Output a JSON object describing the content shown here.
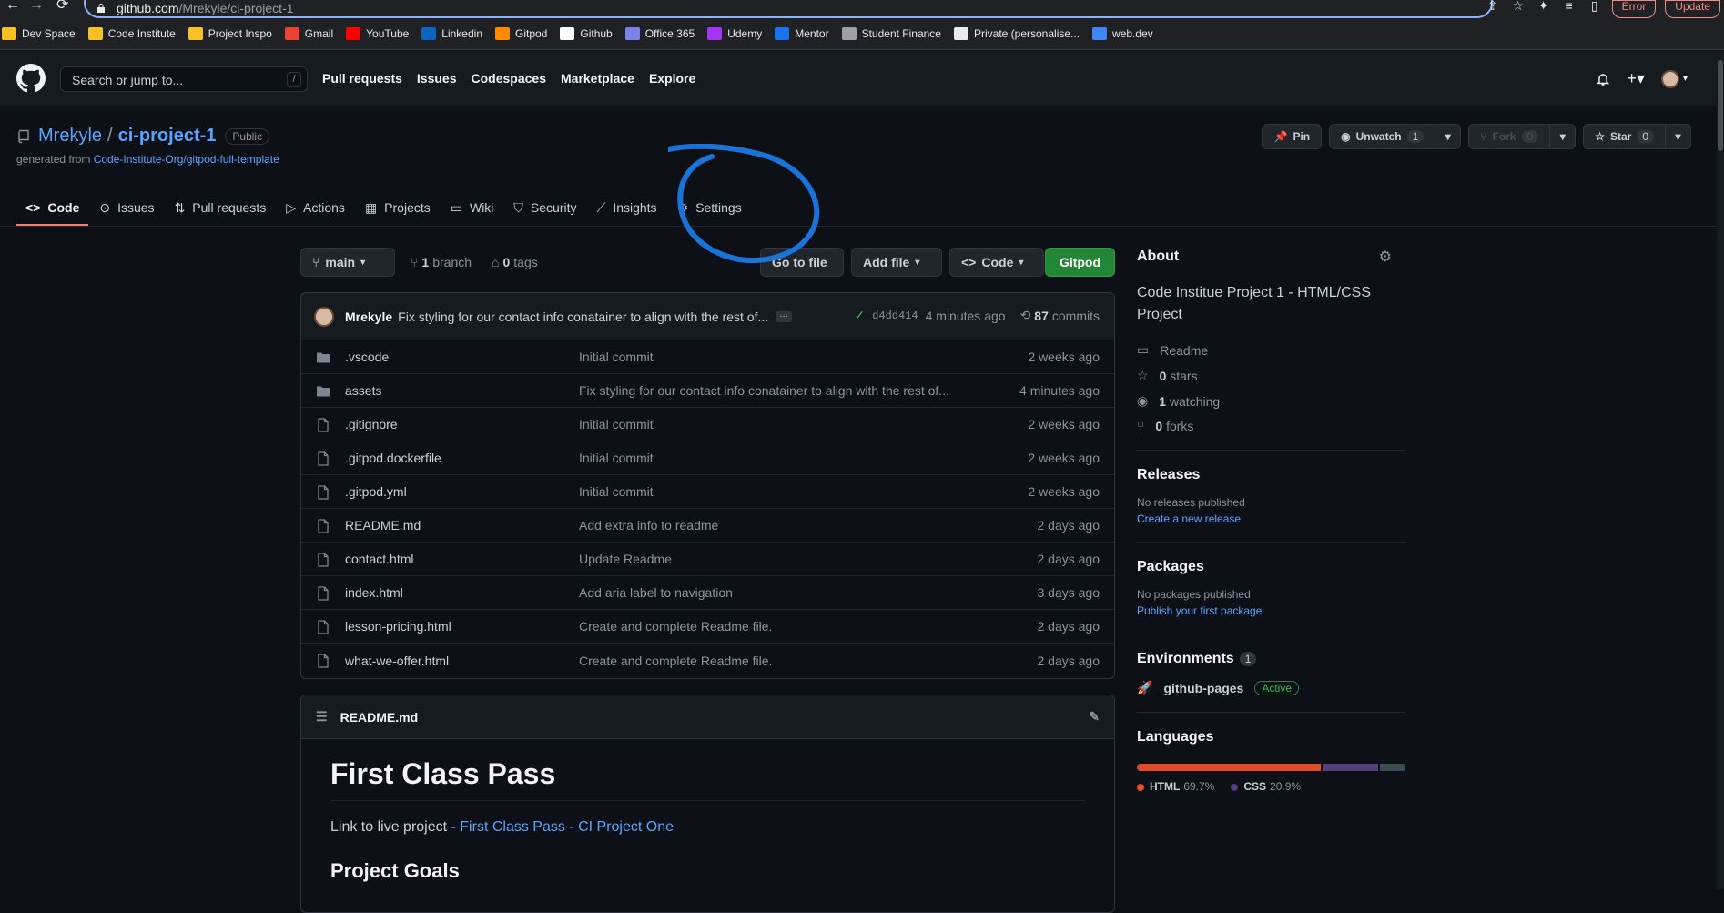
{
  "browser": {
    "url_host": "github.com",
    "url_path": "/Mrekyle/ci-project-1",
    "error_label": "Error",
    "update_label": "Update"
  },
  "bookmarks": [
    {
      "label": "Dev Space",
      "color": "#f6c026"
    },
    {
      "label": "Code Institute",
      "color": "#f6c026"
    },
    {
      "label": "Project Inspo",
      "color": "#f6c026"
    },
    {
      "label": "Gmail",
      "color": "#ea4335"
    },
    {
      "label": "YouTube",
      "color": "#ff0000"
    },
    {
      "label": "Linkedin",
      "color": "#0a66c2"
    },
    {
      "label": "Gitpod",
      "color": "#ff8a00"
    },
    {
      "label": "Github",
      "color": "#ffffff"
    },
    {
      "label": "Office 365",
      "color": "#7b83eb"
    },
    {
      "label": "Udemy",
      "color": "#a435f0"
    },
    {
      "label": "Mentor",
      "color": "#1a73e8"
    },
    {
      "label": "Student Finance",
      "color": "#9aa0a6"
    },
    {
      "label": "Private (personalise...",
      "color": "#e8eaed"
    },
    {
      "label": "web.dev",
      "color": "#4285f4"
    }
  ],
  "header": {
    "search_placeholder": "Search or jump to...",
    "search_shortcut": "/",
    "nav": [
      "Pull requests",
      "Issues",
      "Codespaces",
      "Marketplace",
      "Explore"
    ]
  },
  "repo": {
    "owner": "Mrekyle",
    "sep": "/",
    "name": "ci-project-1",
    "visibility": "Public",
    "generated_prefix": "generated from ",
    "generated_link": "Code-Institute-Org/gitpod-full-template",
    "actions": {
      "pin": "Pin",
      "unwatch": "Unwatch",
      "watch_count": "1",
      "fork": "Fork",
      "fork_count": "0",
      "star": "Star",
      "star_count": "0"
    },
    "tabs": [
      "Code",
      "Issues",
      "Pull requests",
      "Actions",
      "Projects",
      "Wiki",
      "Security",
      "Insights",
      "Settings"
    ]
  },
  "toolbar": {
    "branch": "main",
    "branch_count": "1",
    "branch_label": "branch",
    "tag_count": "0",
    "tag_label": "tags",
    "goto_file": "Go to file",
    "add_file": "Add file",
    "code": "Code",
    "gitpod": "Gitpod"
  },
  "commit": {
    "author": "Mrekyle",
    "message": "Fix styling for our contact info conatainer to align with the rest of...",
    "ellipsis": "…",
    "sha": "d4dd414",
    "time": "4 minutes ago",
    "count": "87",
    "count_label": "commits"
  },
  "files": [
    {
      "type": "dir",
      "name": ".vscode",
      "message": "Initial commit",
      "age": "2 weeks ago"
    },
    {
      "type": "dir",
      "name": "assets",
      "message": "Fix styling for our contact info conatainer to align with the rest of...",
      "age": "4 minutes ago"
    },
    {
      "type": "file",
      "name": ".gitignore",
      "message": "Initial commit",
      "age": "2 weeks ago"
    },
    {
      "type": "file",
      "name": ".gitpod.dockerfile",
      "message": "Initial commit",
      "age": "2 weeks ago"
    },
    {
      "type": "file",
      "name": ".gitpod.yml",
      "message": "Initial commit",
      "age": "2 weeks ago"
    },
    {
      "type": "file",
      "name": "README.md",
      "message": "Add extra info to readme",
      "age": "2 days ago"
    },
    {
      "type": "file",
      "name": "contact.html",
      "message": "Update Readme",
      "age": "2 days ago"
    },
    {
      "type": "file",
      "name": "index.html",
      "message": "Add aria label to navigation",
      "age": "3 days ago"
    },
    {
      "type": "file",
      "name": "lesson-pricing.html",
      "message": "Create and complete Readme file.",
      "age": "2 days ago"
    },
    {
      "type": "file",
      "name": "what-we-offer.html",
      "message": "Create and complete Readme file.",
      "age": "2 days ago"
    }
  ],
  "readme": {
    "filename": "README.md",
    "h1": "First Class Pass",
    "live_prefix": "Link to live project - ",
    "live_link": "First Class Pass - CI Project One",
    "h2": "Project Goals"
  },
  "sidebar": {
    "about_title": "About",
    "about_desc": "Code Institue Project 1 - HTML/CSS Project",
    "readme": "Readme",
    "stars_count": "0",
    "stars_label": "stars",
    "watching_count": "1",
    "watching_label": "watching",
    "forks_count": "0",
    "forks_label": "forks",
    "releases_title": "Releases",
    "releases_none": "No releases published",
    "releases_link": "Create a new release",
    "packages_title": "Packages",
    "packages_none": "No packages published",
    "packages_link": "Publish your first package",
    "environments_title": "Environments",
    "environments_count": "1",
    "env_name": "github-pages",
    "env_status": "Active",
    "languages_title": "Languages",
    "languages": [
      {
        "name": "HTML",
        "percent": "69.7%",
        "value": 69.7,
        "color": "#e34c26"
      },
      {
        "name": "CSS",
        "percent": "20.9%",
        "value": 20.9,
        "color": "#563d7c"
      },
      {
        "name": "",
        "percent": "",
        "value": 9.4,
        "color": "#384d54"
      }
    ]
  },
  "colors": {
    "accent": "#58a6ff",
    "tab_underline": "#f78166",
    "annotation": "#1a73d9"
  }
}
